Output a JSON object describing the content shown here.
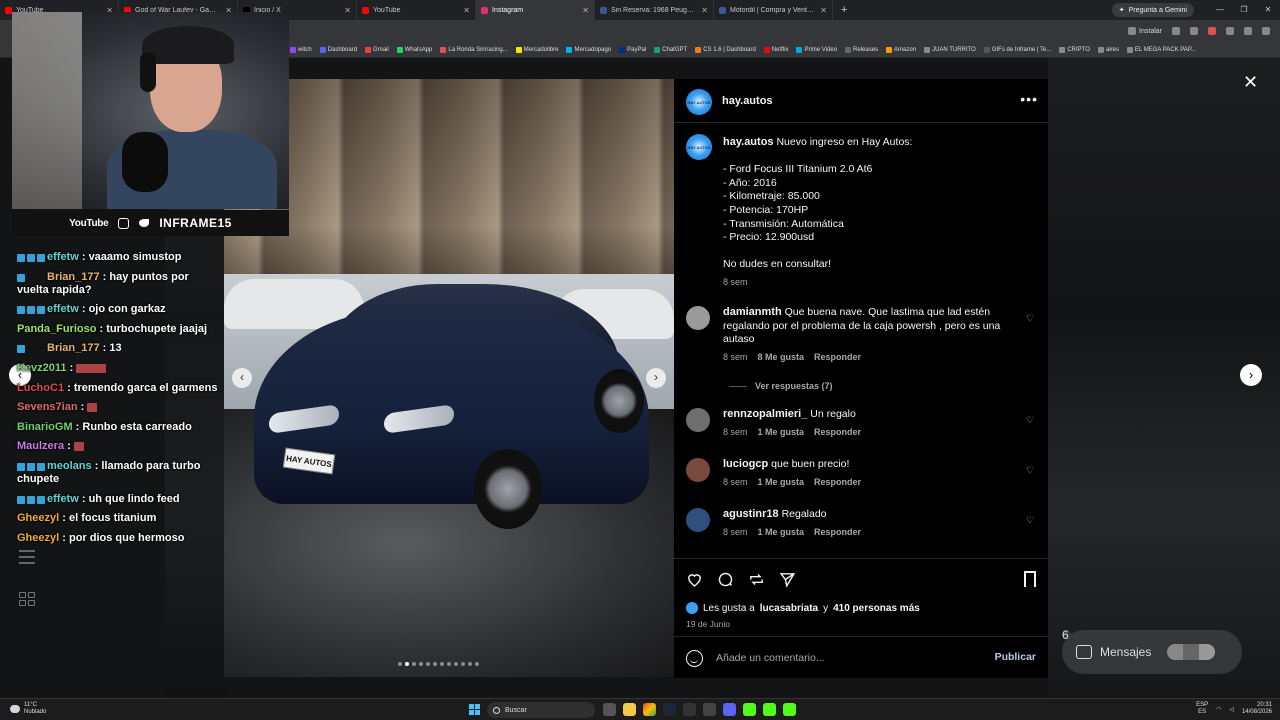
{
  "browser": {
    "tabs": [
      {
        "title": "YouTube",
        "color": "#ff0000"
      },
      {
        "title": "God of War Laufey - Gamepla",
        "color": "#ff0000"
      },
      {
        "title": "Inicio / X",
        "color": "#000000"
      },
      {
        "title": "YouTube",
        "color": "#ff0000"
      },
      {
        "title": "Instagram",
        "color": "#e1306c"
      },
      {
        "title": "Sin Reserva: 1968 Peugeot 404",
        "color": "#3b5998"
      },
      {
        "title": "Motordil | Compra y Venta de",
        "color": "#3b5998"
      }
    ],
    "gemini_label": "Pregunta a Gemini",
    "install_label": "Instalar",
    "bookmarks": [
      "witch",
      "Dashboard",
      "Gmail",
      "WhatsApp",
      "La Ronda Simracing...",
      "Mercadolibre",
      "Mercadopago",
      "PayPal",
      "ChatGPT",
      "CS 1.6 | Dashboard",
      "Netflix",
      "Prime Video",
      "Releases",
      "Amazon",
      "JUAN TURRITO",
      "GIFs de Inframe | Te...",
      "CRIPTO",
      "aires",
      "EL MEGA PACK PAP..."
    ]
  },
  "stream": {
    "platform_label": "YouTube",
    "channel_name": "INFRAME15",
    "chat": [
      {
        "user": "effetw",
        "color": "#5fd3d3",
        "text": "vaaamo simustop",
        "badges": 3
      },
      {
        "user": "Brian_177",
        "color": "#e5b36a",
        "text": "hay puntos por vuelta rapida?",
        "badges": 1
      },
      {
        "user": "effetw",
        "color": "#5fd3d3",
        "text": "ojo con garkaz",
        "badges": 3
      },
      {
        "user": "Panda_Furioso",
        "color": "#9be36b",
        "text": "turbochupete jaajaj",
        "badges": 0
      },
      {
        "user": "Brian_177",
        "color": "#e5b36a",
        "text": "13",
        "badges": 1
      },
      {
        "user": "Kevz2011",
        "color": "#7cd27c",
        "text": "",
        "badges": 0,
        "emote": "wide"
      },
      {
        "user": "LuchoC1",
        "color": "#e04a4a",
        "text": "tremendo garca el garmens",
        "badges": 0
      },
      {
        "user": "Sevens7ian",
        "color": "#e06a6a",
        "text": "",
        "badges": 0,
        "emote": "single"
      },
      {
        "user": "BinarioGM",
        "color": "#6bd36b",
        "text": "Runbo esta carreado",
        "badges": 0
      },
      {
        "user": "Maulzera",
        "color": "#c57be3",
        "text": "",
        "badges": 0,
        "emote": "single"
      },
      {
        "user": "meolans",
        "color": "#5fd3d3",
        "text": "llamado para turbo chupete",
        "badges": 3
      },
      {
        "user": "effetw",
        "color": "#5fd3d3",
        "text": "uh que lindo feed",
        "badges": 3
      },
      {
        "user": "Gheezyl",
        "color": "#f2a93b",
        "text": "el focus titanium",
        "badges": 0
      },
      {
        "user": "Gheezyl",
        "color": "#f2a93b",
        "text": "por dios que hermoso",
        "badges": 0
      }
    ]
  },
  "post": {
    "username": "hay.autos",
    "avatar_label": "HAY AUTOS",
    "plate_text": "HAY AUTOS",
    "caption_lines": [
      "Nuevo ingreso en Hay Autos:",
      "",
      "- Ford Focus III Titanium 2.0 At6",
      "- Año: 2016",
      "- Kilometraje: 85.000",
      "- Potencia: 170HP",
      "- Transmisión: Automática",
      "- Precio: 12.900usd",
      "",
      "No dudes en consultar!"
    ],
    "caption_time": "8 sem",
    "comments": [
      {
        "user": "damianmth",
        "text": "Que buena nave. Que lastima que lad estén regalando por el problema de la caja powersh , pero es una autaso",
        "time": "8 sem",
        "likes": "8 Me gusta",
        "reply": "Responder",
        "avatar_color": "#9a9a9a"
      },
      {
        "user": "rennzopalmieri_",
        "text": "Un regalo",
        "time": "8 sem",
        "likes": "1 Me gusta",
        "reply": "Responder",
        "avatar_color": "#6f6f6f"
      },
      {
        "user": "luciogcp",
        "text": "que buen precio!",
        "time": "8 sem",
        "likes": "1 Me gusta",
        "reply": "Responder",
        "avatar_color": "#7a4b3c"
      },
      {
        "user": "agustinr18",
        "text": "Regalado",
        "time": "8 sem",
        "likes": "1 Me gusta",
        "reply": "Responder",
        "avatar_color": "#2f4f7f"
      }
    ],
    "view_replies": "Ver respuestas (7)",
    "likes_prefix": "Les gusta a",
    "likes_user": "lucasabriata",
    "likes_middle": "y",
    "likes_count": "410 personas más",
    "date": "19 de Junio",
    "comment_placeholder": "Añade un comentario...",
    "publish_label": "Publicar",
    "carousel": {
      "total": 12,
      "current": 2
    }
  },
  "messages_label": "Mensajes",
  "messages_badge": "6",
  "taskbar": {
    "temp": "11°C",
    "weather": "Nublado",
    "search_label": "Buscar",
    "lang_top": "ESP",
    "lang_bottom": "ES",
    "time": "20:31",
    "date": "14/08/2026"
  }
}
